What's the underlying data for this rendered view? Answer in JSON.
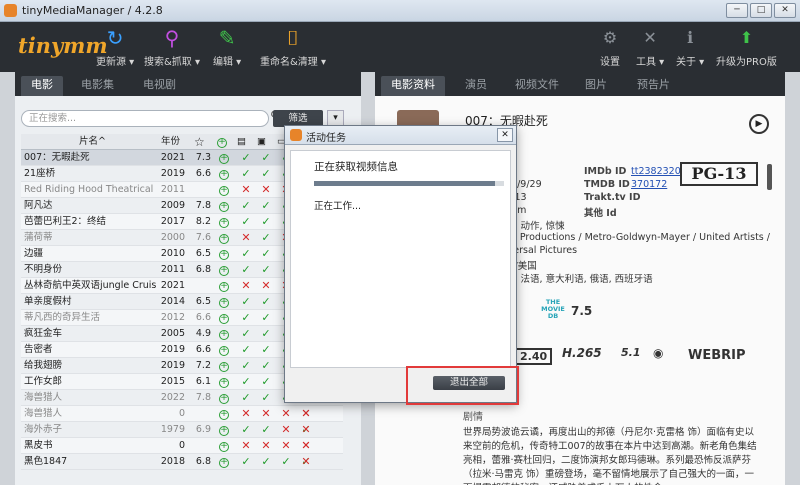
{
  "window": {
    "title": "tinyMediaManager / 4.2.8",
    "controls": [
      "─",
      "□",
      "✕"
    ]
  },
  "toolbar": {
    "logo": "tinymm",
    "buttons": [
      {
        "label": "更新源 ▾",
        "icon": "refresh-icon",
        "glyph": "↻",
        "color": "#3aa0ff"
      },
      {
        "label": "搜索&抓取 ▾",
        "icon": "search-scrape-icon",
        "glyph": "⚲",
        "color": "#c14fe0"
      },
      {
        "label": "编辑 ▾",
        "icon": "edit-icon",
        "glyph": "✎",
        "color": "#3fc24a"
      },
      {
        "label": "重命名&清理 ▾",
        "icon": "rename-icon",
        "glyph": "⌷",
        "color": "#f0a62a"
      }
    ],
    "right_buttons": [
      {
        "label": "设置",
        "icon": "settings-icon",
        "glyph": "⚙"
      },
      {
        "label": "工具 ▾",
        "icon": "tools-icon",
        "glyph": "✕"
      },
      {
        "label": "关于 ▾",
        "icon": "info-icon",
        "glyph": "ℹ"
      },
      {
        "label": "升级为PRO版",
        "icon": "upgrade-arrow-icon",
        "glyph": "⬆"
      }
    ]
  },
  "left_tabs": [
    "电影",
    "电影集",
    "电视剧"
  ],
  "right_tabs": [
    "电影资料",
    "演员",
    "视频文件",
    "图片",
    "预告片"
  ],
  "search": {
    "placeholder": "正在搜索...",
    "filter_label": "筛选"
  },
  "table": {
    "headers": {
      "title": "片名^",
      "year": "年份",
      "rating": "☆"
    },
    "rows": [
      {
        "title": "007：无暇赴死",
        "year": "2021",
        "rating": "7.3",
        "marks": [
          "g",
          "g",
          "g"
        ],
        "sel": true
      },
      {
        "title": "21座桥",
        "year": "2019",
        "rating": "6.6",
        "marks": [
          "g",
          "g",
          "g"
        ]
      },
      {
        "title": "Red Riding Hood Theatrical",
        "year": "2011",
        "rating": "",
        "marks": [
          "r",
          "r",
          "r"
        ],
        "dim": true
      },
      {
        "title": "阿凡达",
        "year": "2009",
        "rating": "7.8",
        "marks": [
          "g",
          "g",
          "g"
        ]
      },
      {
        "title": "芭蕾巴利王2：终结",
        "year": "2017",
        "rating": "8.2",
        "marks": [
          "g",
          "g",
          "g"
        ]
      },
      {
        "title": "蒲荷蒂",
        "year": "2000",
        "rating": "7.6",
        "marks": [
          "r",
          "g",
          "r"
        ],
        "dim": true
      },
      {
        "title": "边疆",
        "year": "2010",
        "rating": "6.5",
        "marks": [
          "g",
          "g",
          "g"
        ]
      },
      {
        "title": "不明身份",
        "year": "2011",
        "rating": "6.8",
        "marks": [
          "g",
          "g",
          "g"
        ]
      },
      {
        "title": "丛林奇航中英双语jungle Cruise",
        "year": "2021",
        "rating": "",
        "marks": [
          "r",
          "r",
          "r"
        ]
      },
      {
        "title": "单亲度假村",
        "year": "2014",
        "rating": "6.5",
        "marks": [
          "g",
          "g",
          "g"
        ]
      },
      {
        "title": "蒂凡西的奇异生活",
        "year": "2012",
        "rating": "6.6",
        "marks": [
          "g",
          "g",
          "g"
        ],
        "dim": true
      },
      {
        "title": "疯狂金车",
        "year": "2005",
        "rating": "4.9",
        "marks": [
          "g",
          "g",
          "g"
        ]
      },
      {
        "title": "告密者",
        "year": "2019",
        "rating": "6.6",
        "marks": [
          "g",
          "g",
          "g"
        ]
      },
      {
        "title": "给我翅膀",
        "year": "2019",
        "rating": "7.2",
        "marks": [
          "g",
          "g",
          "g"
        ]
      },
      {
        "title": "工作女郎",
        "year": "2015",
        "rating": "6.1",
        "marks": [
          "g",
          "g",
          "g"
        ]
      },
      {
        "title": "海兽猎人",
        "year": "2022",
        "rating": "7.8",
        "marks": [
          "g",
          "g",
          "g",
          "g",
          "r"
        ],
        "dim": true
      },
      {
        "title": "海兽猎人",
        "year": "0",
        "rating": "",
        "marks": [
          "r",
          "r",
          "r",
          "r",
          "r"
        ],
        "dim": true
      },
      {
        "title": "海外赤子",
        "year": "1979",
        "rating": "6.9",
        "marks": [
          "g",
          "g",
          "r",
          "g",
          "r"
        ],
        "dim": true
      },
      {
        "title": "黑皮书",
        "year": "0",
        "rating": "",
        "marks": [
          "r",
          "r",
          "r",
          "r",
          "r"
        ]
      },
      {
        "title": "黑色1847",
        "year": "2018",
        "rating": "6.8",
        "marks": [
          "g",
          "g",
          "g",
          "g",
          "r"
        ]
      }
    ]
  },
  "movie": {
    "title": "007：无暇赴死",
    "year_tail": "21",
    "date_tail": "21/9/29",
    "runtime_prefix": "5-13",
    "duration": "43m",
    "genres": "险, 动作, 惊悚",
    "studios": "on Productions / Metro-Goldwyn-Mayer / United Artists /",
    "studios2": "iversal Pictures",
    "country": "国/美国",
    "languages": "语, 法语, 意大利语, 俄语, 西班牙语",
    "imdb_label": "IMDb ID",
    "imdb_value": "tt2382320",
    "tmdb_label": "TMDB ID",
    "tmdb_value": "370172",
    "trakt_label": "Trakt.tv ID",
    "other_label": "其他 Id",
    "certification": "PG-13",
    "rating_tail": "3",
    "tmdb_rating": "7.5",
    "tmdb_logo": "THE MOVIE DB",
    "video_badges": [
      "2.40",
      "H.265",
      "5.1",
      "WEBRIP"
    ],
    "plot_label": "剧情",
    "plot": "世界局势波诡云谲，再度出山的邦德（丹尼尔·克雷格 饰）面临有史以来空前的危机，传奇特工007的故事在本片中达到高潮。新老角色集结亮相，蕾雅·赛杜回归，二度饰演邦女郎玛德琳。系列最恐怖反派萨芬（拉米·马雷克 饰）重磅登场，毫不留情地展示了自己强大的一面，一面揭露邦德的秘密，还威胁着成千上万人的性命。"
  },
  "dialog": {
    "title": "活动任务",
    "task": "正在获取视频信息",
    "progress": 0.95,
    "status": "正在工作...",
    "abort_label": "退出全部"
  }
}
